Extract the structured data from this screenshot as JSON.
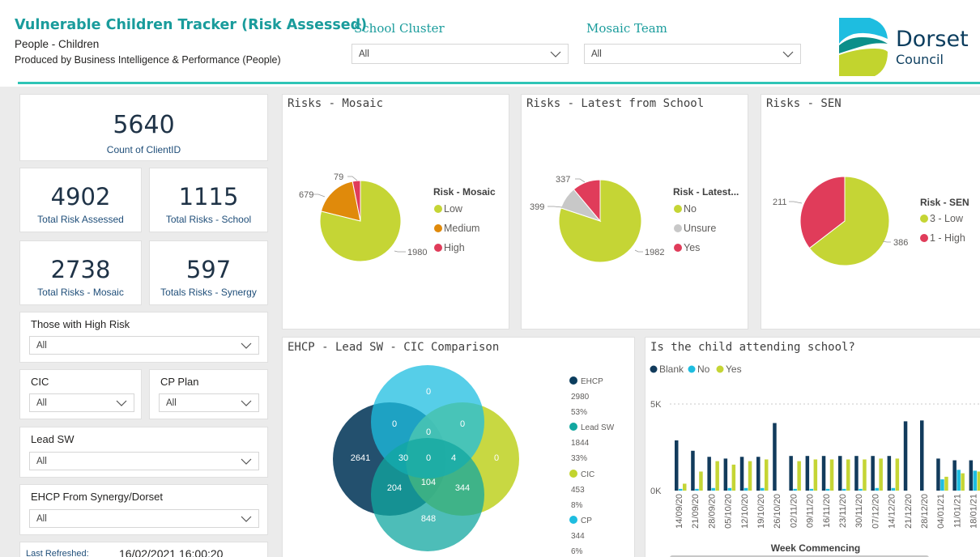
{
  "header": {
    "title": "Vulnerable Children Tracker (Risk Assessed)",
    "subtitle": "People - Children",
    "produced_by": "Produced by Business Intelligence & Performance (People)"
  },
  "top_slicers": {
    "school_cluster": {
      "label": "School Cluster",
      "value": "All"
    },
    "mosaic_team": {
      "label": "Mosaic Team",
      "value": "All"
    }
  },
  "logo": {
    "line1": "Dorset",
    "line2": "Council"
  },
  "kpis": {
    "count_clientid": {
      "value": "5640",
      "label": "Count of ClientID"
    },
    "total_risk_assessed": {
      "value": "4902",
      "label": "Total Risk Assessed"
    },
    "total_risks_school": {
      "value": "1115",
      "label": "Total Risks - School"
    },
    "total_risks_mosaic": {
      "value": "2738",
      "label": "Total Risks - Mosaic"
    },
    "totals_risks_synergy": {
      "value": "597",
      "label": "Totals Risks - Synergy"
    }
  },
  "slicers": {
    "high_risk": {
      "label": "Those with High Risk",
      "value": "All"
    },
    "cic": {
      "label": "CIC",
      "value": "All"
    },
    "cp_plan": {
      "label": "CP Plan",
      "value": "All"
    },
    "lead_sw": {
      "label": "Lead SW",
      "value": "All"
    },
    "ehcp": {
      "label": "EHCP From Synergy/Dorset",
      "value": "All"
    }
  },
  "refresh": {
    "label": "Last Refreshed:",
    "value": "16/02/2021 16:00:20"
  },
  "colors": {
    "accent": "#1a9c9c",
    "low": "#c5d535",
    "medium": "#e08a0b",
    "high": "#e03c5a",
    "unsure": "#c8c8c8",
    "blank": "#123b5c",
    "no": "#1ebde0",
    "yes": "#c5d535",
    "ehcp": "#0b3d5e",
    "lead_sw": "#12a7a0",
    "cic": "#c2d42e",
    "cp": "#1ebde0"
  },
  "pies": {
    "mosaic": {
      "title": "Risks - Mosaic",
      "legend_title": "Risk - Mosaic",
      "labels": [
        "1980",
        "679",
        "79"
      ],
      "legend": [
        "Low",
        "Medium",
        "High"
      ]
    },
    "school": {
      "title": "Risks - Latest from School",
      "legend_title": "Risk - Latest...",
      "labels": [
        "1982",
        "399",
        "337"
      ],
      "legend": [
        "No",
        "Unsure",
        "Yes"
      ]
    },
    "sen": {
      "title": "Risks - SEN",
      "legend_title": "Risk - SEN",
      "labels": [
        "386",
        "211"
      ],
      "legend": [
        "3 - Low",
        "1 - High"
      ]
    }
  },
  "venn": {
    "title": "EHCP - Lead SW - CIC Comparison",
    "numbers": {
      "cp_only": "0",
      "cp_ehcp": "0",
      "cp_cic": "0",
      "center_top": "0",
      "ehcp_only": "2641",
      "ehcp_cp_lead": "30",
      "center": "0",
      "cic_cp_lead": "4",
      "cic_only": "0",
      "ehcp_lead": "204",
      "lead_ehcp_cic": "104",
      "lead_cic": "344",
      "lead_only": "848"
    },
    "legend": [
      {
        "name": "EHCP",
        "count": "2980",
        "pct": "53%"
      },
      {
        "name": "Lead SW",
        "count": "1844",
        "pct": "33%"
      },
      {
        "name": "CIC",
        "count": "453",
        "pct": "8%"
      },
      {
        "name": "CP",
        "count": "344",
        "pct": "6%"
      }
    ]
  },
  "chart_data": {
    "type": "bar",
    "title": "Is the child attending school?",
    "xlabel": "Week Commencing",
    "ylabel": "",
    "y_ticks": [
      "5K",
      "0K"
    ],
    "ylim": [
      0,
      5000
    ],
    "categories": [
      "14/09/20",
      "21/09/20",
      "28/09/20",
      "05/10/20",
      "12/10/20",
      "19/10/20",
      "26/10/20",
      "02/11/20",
      "09/11/20",
      "16/11/20",
      "23/11/20",
      "30/11/20",
      "07/12/20",
      "14/12/20",
      "21/12/20",
      "28/12/20",
      "04/01/21",
      "11/01/21",
      "18/01/21"
    ],
    "series": [
      {
        "name": "Blank",
        "values": [
          2900,
          2300,
          1950,
          1850,
          1950,
          1950,
          3900,
          2000,
          2000,
          2000,
          2000,
          2000,
          2000,
          2000,
          4000,
          4050,
          1850,
          1750,
          1750
        ]
      },
      {
        "name": "No",
        "values": [
          100,
          100,
          150,
          150,
          150,
          150,
          0,
          100,
          100,
          100,
          100,
          100,
          150,
          150,
          0,
          0,
          650,
          1200,
          1150
        ]
      },
      {
        "name": "Yes",
        "values": [
          400,
          1100,
          1700,
          1500,
          1700,
          1800,
          0,
          1700,
          1800,
          1800,
          1800,
          1800,
          1850,
          1850,
          0,
          0,
          800,
          1000,
          1100
        ]
      }
    ],
    "legend": [
      "Blank",
      "No",
      "Yes"
    ],
    "legend_position": "top-left",
    "grid": true
  }
}
